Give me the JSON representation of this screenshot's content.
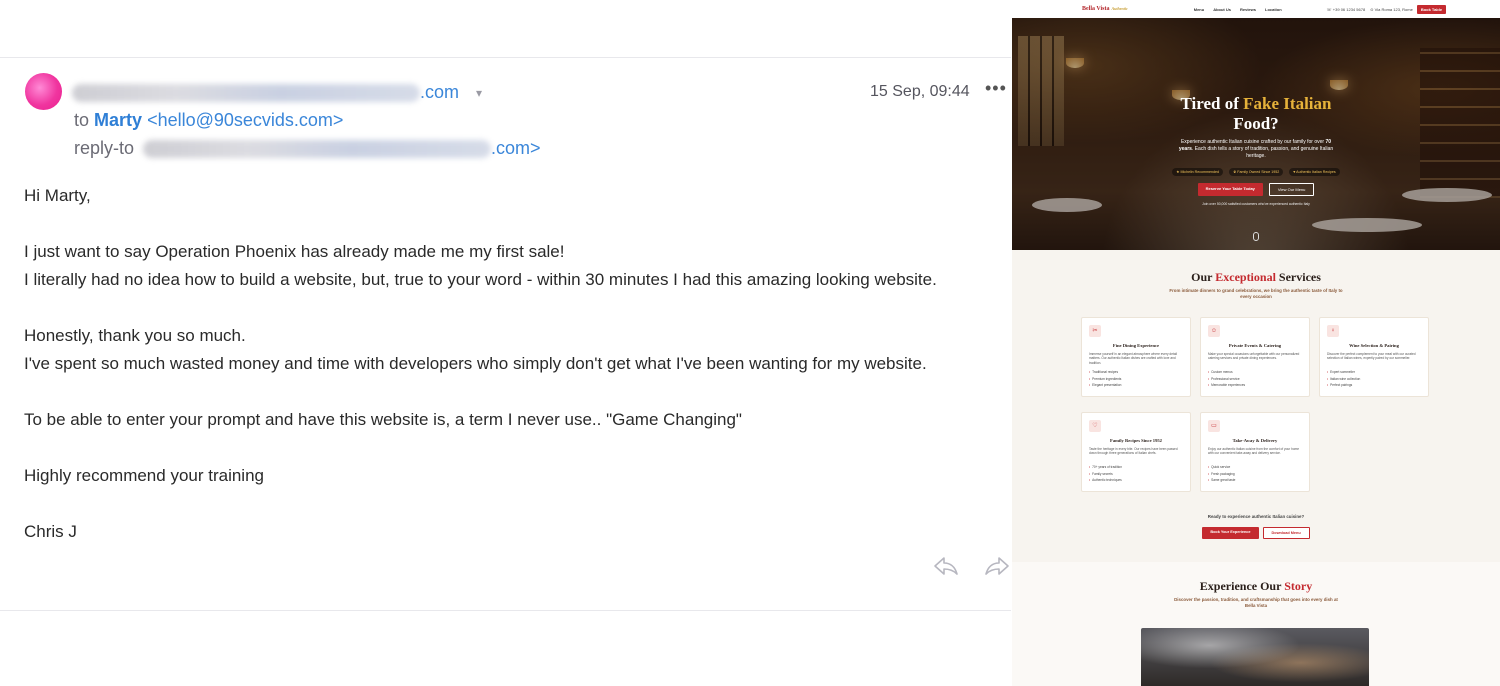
{
  "email": {
    "from_suffix": ".com",
    "date": "15 Sep, 09:44",
    "more_label": "•••",
    "to_prefix": "to",
    "to_name": "Marty",
    "to_address": "<hello@90secvids.com>",
    "reply_prefix": "reply-to",
    "reply_suffix": ".com>",
    "body": [
      "Hi Marty,",
      "",
      "I just want to say Operation Phoenix has already made me my first sale!",
      "I literally had no idea how to build a website, but, true to your word - within 30 minutes I had this amazing looking website.",
      "",
      "Honestly, thank you so much.",
      "I've spent so much wasted money and time with developers who simply don't get what I've been wanting for my website.",
      "",
      "To be able to enter your prompt and have this website is, a term I never use.. \"Game Changing\"",
      "",
      "Highly recommend your training",
      "",
      "Chris J"
    ]
  },
  "site": {
    "logo": "Bella Vista",
    "logo_tag": "Authentic",
    "nav": [
      "Menu",
      "About Us",
      "Reviews",
      "Location"
    ],
    "phone": "+39 06 1234 5678",
    "address": "Via Roma 123, Rome",
    "nav_cta": "Book Table",
    "hero": {
      "title_a": "Tired of ",
      "title_gold": "Fake Italian",
      "title_b": "Food?",
      "sub_a": "Experience authentic Italian cuisine crafted by our family",
      "sub_b": "for over ",
      "sub_bold": "70 years",
      "sub_c": ". Each dish tells a story of tradition, passion, and genuine Italian heritage.",
      "badges": [
        "Michelin Recommended",
        "Family Owned Since 1952",
        "Authentic Italian Recipes"
      ],
      "btn_primary": "Reserve Your Table Today",
      "btn_secondary": "View Our Menu",
      "note": "Join over 50,000 satisfied customers who've experienced authentic Italy"
    },
    "services": {
      "title_a": "Our ",
      "title_red": "Exceptional",
      "title_b": " Services",
      "sub": "From intimate dinners to grand celebrations, we bring the authentic taste of Italy to every occasion",
      "cards": [
        {
          "icon": "✂",
          "title": "Fine Dining Experience",
          "text": "Immerse yourself in an elegant atmosphere where every detail matters. Our authentic Italian dishes are crafted with love and tradition.",
          "items": [
            "Traditional recipes",
            "Premium ingredients",
            "Elegant presentation"
          ]
        },
        {
          "icon": "☺",
          "title": "Private Events & Catering",
          "text": "Make your special occasions unforgettable with our personalized catering services and private dining experiences.",
          "items": [
            "Custom menus",
            "Professional service",
            "Memorable experiences"
          ]
        },
        {
          "icon": "♀",
          "title": "Wine Selection & Pairing",
          "text": "Discover the perfect complement to your meal with our curated selection of Italian wines, expertly paired by our sommelier.",
          "items": [
            "Expert sommelier",
            "Italian wine collection",
            "Perfect pairings"
          ]
        },
        {
          "icon": "♡",
          "title": "Family Recipes Since 1952",
          "text": "Taste the heritage in every bite. Our recipes have been passed down through three generations of Italian chefs.",
          "items": [
            "70+ years of tradition",
            "Family secrets",
            "Authentic techniques"
          ]
        },
        {
          "icon": "▭",
          "title": "Take-Away & Delivery",
          "text": "Enjoy our authentic Italian cuisine from the comfort of your home with our convenient take-away and delivery service.",
          "items": [
            "Quick service",
            "Fresh packaging",
            "Same great taste"
          ]
        }
      ],
      "cta_question": "Ready to experience authentic Italian cuisine?",
      "cta_primary": "Book Your Experience",
      "cta_secondary": "Download Menu"
    },
    "story": {
      "title_a": "Experience Our ",
      "title_red": "Story",
      "sub": "Discover the passion, tradition, and craftsmanship that goes into every dish at Bella Vista"
    }
  }
}
